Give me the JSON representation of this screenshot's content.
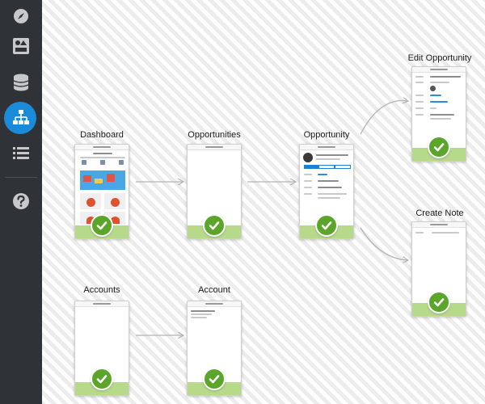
{
  "sidebar": {
    "items": [
      {
        "icon": "compass-icon"
      },
      {
        "icon": "widgets-icon"
      },
      {
        "icon": "database-icon"
      },
      {
        "icon": "sitemap-icon",
        "active": true
      },
      {
        "icon": "list-icon"
      },
      {
        "icon": "help-icon"
      }
    ]
  },
  "flow": {
    "pages": [
      {
        "title": "Dashboard"
      },
      {
        "title": "Opportunities"
      },
      {
        "title": "Opportunity"
      },
      {
        "title": "Edit Opportunity"
      },
      {
        "title": "Create Note"
      },
      {
        "title": "Accounts"
      },
      {
        "title": "Account"
      }
    ]
  },
  "colors": {
    "sidebar_bg": "#2f3236",
    "accent": "#1a8bd8",
    "check_green": "#5aa52a",
    "footer_green": "#b6d98a"
  }
}
